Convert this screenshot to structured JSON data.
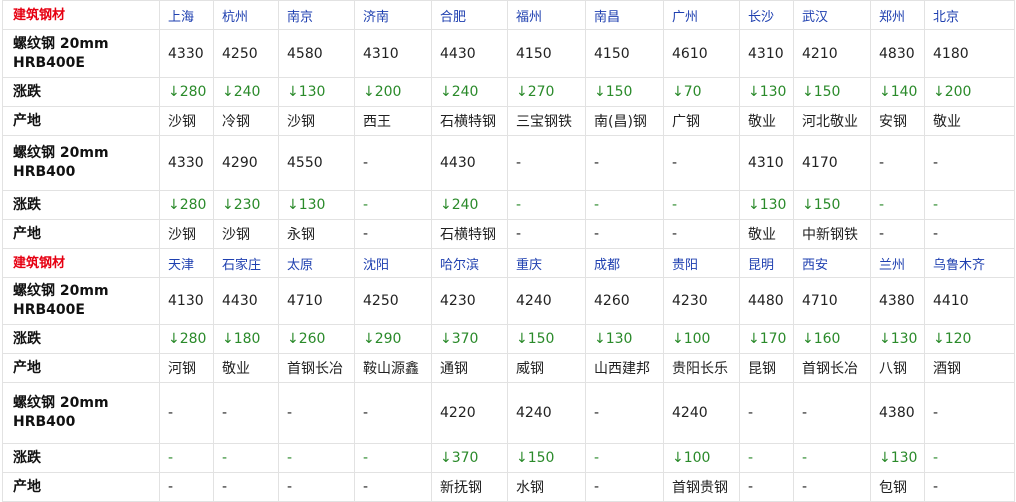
{
  "blocks": [
    {
      "header_label": "建筑钢材",
      "cities": [
        "上海",
        "杭州",
        "南京",
        "济南",
        "合肥",
        "福州",
        "南昌",
        "广州",
        "长沙",
        "武汉",
        "郑州",
        "北京"
      ],
      "products": [
        {
          "name_line1": "螺纹钢 20mm",
          "name_line2": "HRB400E",
          "prices": [
            "4330",
            "4250",
            "4580",
            "4310",
            "4430",
            "4150",
            "4150",
            "4610",
            "4310",
            "4210",
            "4830",
            "4180"
          ],
          "change_label": "涨跌",
          "changes": [
            "↓280",
            "↓240",
            "↓130",
            "↓200",
            "↓240",
            "↓270",
            "↓150",
            "↓70",
            "↓130",
            "↓150",
            "↓140",
            "↓200"
          ],
          "origin_label": "产地",
          "origins": [
            "沙钢",
            "冷钢",
            "沙钢",
            "西王",
            "石横特钢",
            "三宝钢铁",
            "南(昌)钢",
            "广钢",
            "敬业",
            "河北敬业",
            "安钢",
            "敬业"
          ]
        },
        {
          "name_line1": "螺纹钢 20mm",
          "name_line2": "HRB400",
          "prices": [
            "4330",
            "4290",
            "4550",
            "-",
            "4430",
            "-",
            "-",
            "-",
            "4310",
            "4170",
            "-",
            "-"
          ],
          "change_label": "涨跌",
          "changes": [
            "↓280",
            "↓230",
            "↓130",
            "-",
            "↓240",
            "-",
            "-",
            "-",
            "↓130",
            "↓150",
            "-",
            "-"
          ],
          "origin_label": "产地",
          "origins": [
            "沙钢",
            "沙钢",
            "永钢",
            "-",
            "石横特钢",
            "-",
            "-",
            "-",
            "敬业",
            "中新钢铁",
            "-",
            "-"
          ]
        }
      ]
    },
    {
      "header_label": "建筑钢材",
      "cities": [
        "天津",
        "石家庄",
        "太原",
        "沈阳",
        "哈尔滨",
        "重庆",
        "成都",
        "贵阳",
        "昆明",
        "西安",
        "兰州",
        "乌鲁木齐"
      ],
      "products": [
        {
          "name_line1": "螺纹钢 20mm",
          "name_line2": "HRB400E",
          "prices": [
            "4130",
            "4430",
            "4710",
            "4250",
            "4230",
            "4240",
            "4260",
            "4230",
            "4480",
            "4710",
            "4380",
            "4410"
          ],
          "change_label": "涨跌",
          "changes": [
            "↓280",
            "↓180",
            "↓260",
            "↓290",
            "↓370",
            "↓150",
            "↓130",
            "↓100",
            "↓170",
            "↓160",
            "↓130",
            "↓120"
          ],
          "origin_label": "产地",
          "origins": [
            "河钢",
            "敬业",
            "首钢长冶",
            "鞍山源鑫",
            "通钢",
            "威钢",
            "山西建邦",
            "贵阳长乐",
            "昆钢",
            "首钢长冶",
            "八钢",
            "酒钢"
          ]
        },
        {
          "name_line1": "螺纹钢 20mm",
          "name_line2": "HRB400",
          "prices": [
            "-",
            "-",
            "-",
            "-",
            "4220",
            "4240",
            "-",
            "4240",
            "-",
            "-",
            "4380",
            "-"
          ],
          "change_label": "涨跌",
          "changes": [
            "-",
            "-",
            "-",
            "-",
            "↓370",
            "↓150",
            "-",
            "↓100",
            "-",
            "-",
            "↓130",
            "-"
          ],
          "origin_label": "产地",
          "origins": [
            "-",
            "-",
            "-",
            "-",
            "新抚钢",
            "水钢",
            "-",
            "首钢贵钢",
            "-",
            "-",
            "包钢",
            "-"
          ]
        }
      ]
    }
  ]
}
